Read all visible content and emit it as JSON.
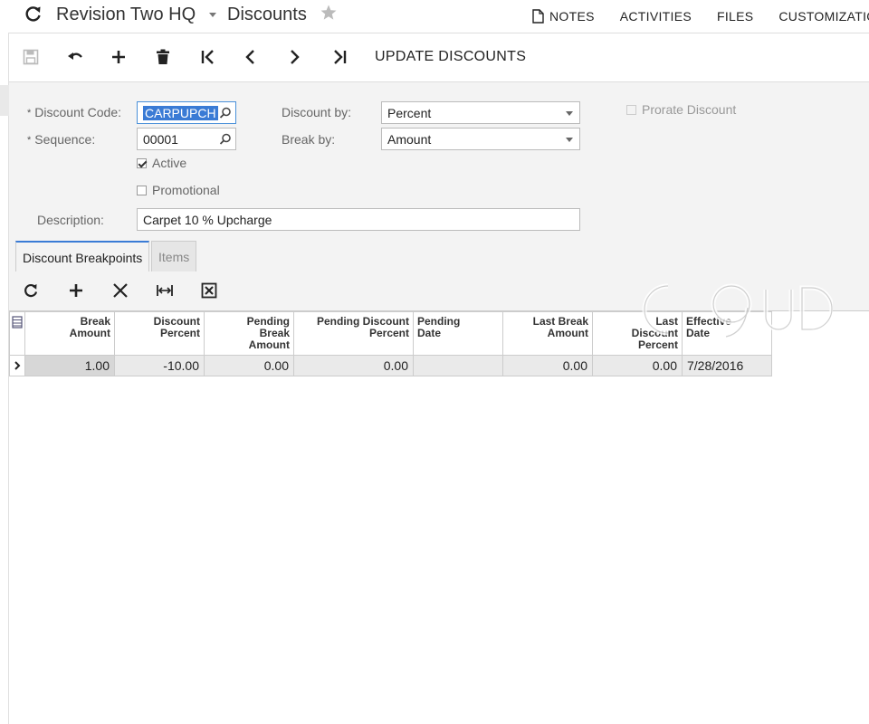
{
  "header": {
    "company": "Revision Two HQ",
    "title": "Discounts",
    "links": [
      "NOTES",
      "ACTIVITIES",
      "FILES",
      "CUSTOMIZATION"
    ]
  },
  "toolbar": {
    "update_label": "UPDATE DISCOUNTS"
  },
  "form": {
    "discount_code_label": "Discount Code:",
    "discount_code_value": "CARPUPCH",
    "sequence_label": "Sequence:",
    "sequence_value": "00001",
    "active_label": "Active",
    "active_checked": true,
    "promotional_label": "Promotional",
    "promotional_checked": false,
    "description_label": "Description:",
    "description_value": "Carpet 10 % Upcharge",
    "discount_by_label": "Discount by:",
    "discount_by_value": "Percent",
    "break_by_label": "Break by:",
    "break_by_value": "Amount",
    "prorate_label": "Prorate Discount",
    "prorate_checked": false
  },
  "tabs": [
    {
      "label": "Discount Breakpoints",
      "active": true
    },
    {
      "label": "Items",
      "active": false
    }
  ],
  "grid": {
    "columns": [
      {
        "line1": "Break",
        "line2": "Amount",
        "line3": ""
      },
      {
        "line1": "Discount",
        "line2": "Percent",
        "line3": ""
      },
      {
        "line1": "Pending",
        "line2": "Break",
        "line3": "Amount"
      },
      {
        "line1": "Pending Discount",
        "line2": "Percent",
        "line3": ""
      },
      {
        "line1": "Pending",
        "line2": "Date",
        "line3": ""
      },
      {
        "line1": "Last Break",
        "line2": "Amount",
        "line3": ""
      },
      {
        "line1": "Last",
        "line2": "Discount",
        "line3": "Percent"
      },
      {
        "line1": "Effective",
        "line2": "Date",
        "line3": ""
      }
    ],
    "rows": [
      {
        "break_amount": "1.00",
        "discount_percent": "-10.00",
        "pending_break_amount": "0.00",
        "pending_discount_percent": "0.00",
        "pending_date": "",
        "last_break_amount": "0.00",
        "last_discount_percent": "0.00",
        "effective_date": "7/28/2016"
      }
    ]
  },
  "icons": {
    "refresh": "refresh-icon",
    "star": "star-icon",
    "save": "save-icon",
    "undo": "undo-icon",
    "add": "plus-icon",
    "delete": "trash-icon",
    "first": "first-record-icon",
    "prev": "chevron-left-icon",
    "next": "chevron-right-icon",
    "last": "last-record-icon",
    "grid_refresh": "refresh-icon",
    "grid_add": "plus-icon",
    "grid_delete": "close-icon",
    "fit_columns": "fit-width-icon",
    "export": "excel-icon"
  },
  "colors": {
    "accent": "#3a7bd5",
    "panel": "#f3f3f3"
  }
}
